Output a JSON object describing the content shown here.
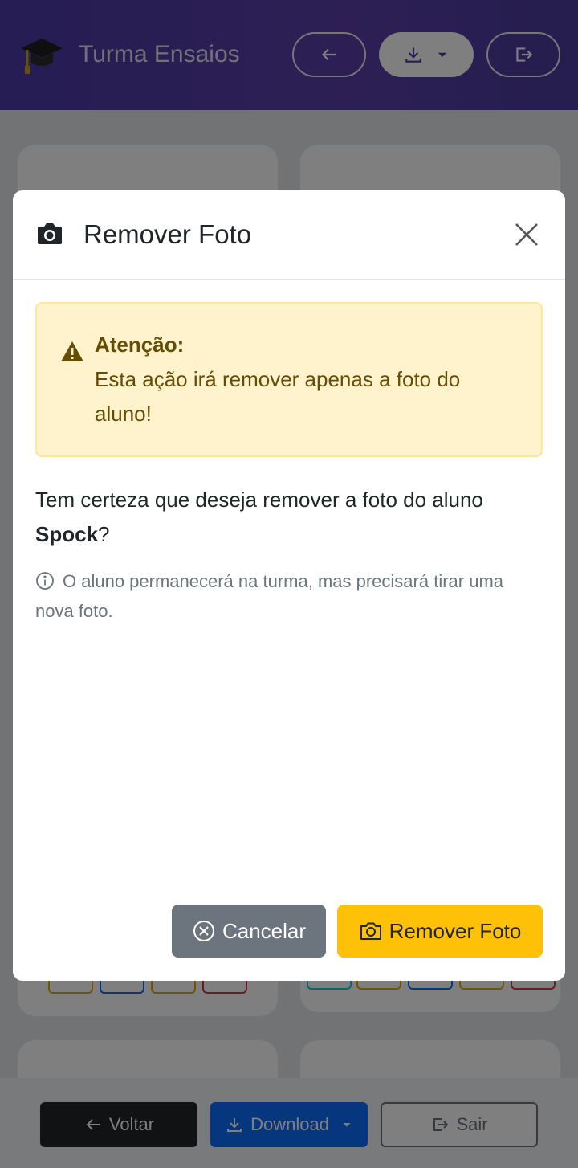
{
  "header": {
    "title": "Turma Ensaios",
    "icons": [
      "graduation-cap-icon",
      "arrow-left-icon",
      "download-icon",
      "caret-down-icon",
      "exit-icon"
    ]
  },
  "bottom_bar": {
    "back_label": "Voltar",
    "download_label": "Download",
    "exit_label": "Sair"
  },
  "modal": {
    "title": "Remover Foto",
    "alert": {
      "heading": "Atenção:",
      "message": "Esta ação irá remover apenas a foto do aluno!"
    },
    "confirm_prefix": "Tem certeza que deseja remover a foto do aluno ",
    "student_name": "Spock",
    "confirm_suffix": "?",
    "note": "O aluno permanecerá na turma, mas precisará tirar uma nova foto.",
    "cancel_label": "Cancelar",
    "remove_label": "Remover Foto"
  },
  "colors": {
    "header": "#4b3aa8",
    "warning_bg": "#fff3cd",
    "warning_text": "#664d03",
    "cancel": "#6c757d",
    "remove": "#ffc107",
    "download": "#0d6efd"
  }
}
